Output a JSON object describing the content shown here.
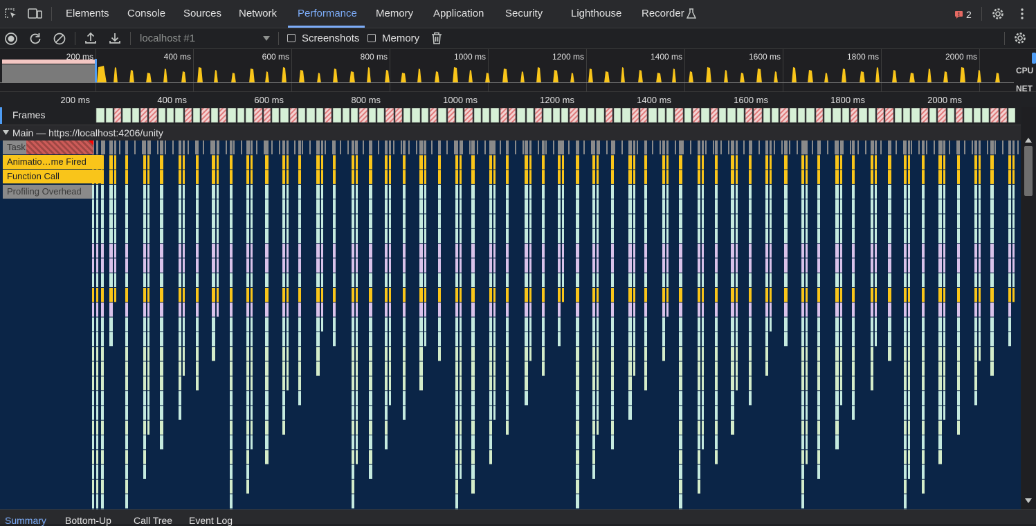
{
  "tabs": [
    {
      "label": "Elements"
    },
    {
      "label": "Console"
    },
    {
      "label": "Sources"
    },
    {
      "label": "Network"
    },
    {
      "label": "Performance",
      "active": true
    },
    {
      "label": "Memory"
    },
    {
      "label": "Application"
    },
    {
      "label": "Security"
    },
    {
      "label": "Lighthouse"
    },
    {
      "label": "Recorder"
    }
  ],
  "issues": {
    "count": "2",
    "color": "#e46962"
  },
  "toolbar": {
    "target_placeholder": "localhost #1",
    "screenshots_label": "Screenshots",
    "screenshots_checked": false,
    "memory_label": "Memory",
    "memory_checked": false
  },
  "overview": {
    "ticks": [
      "200 ms",
      "400 ms",
      "600 ms",
      "800 ms",
      "1000 ms",
      "1200 ms",
      "1400 ms",
      "1600 ms",
      "1800 ms",
      "2000 ms"
    ],
    "cpu_label": "CPU",
    "net_label": "NET",
    "cpu_color": "#f9c51a"
  },
  "ruler": {
    "ticks": [
      "200 ms",
      "400 ms",
      "600 ms",
      "800 ms",
      "1000 ms",
      "1200 ms",
      "1400 ms",
      "1600 ms",
      "1800 ms",
      "2000 ms"
    ]
  },
  "frames": {
    "label": "Frames",
    "good_color": "#d6f0d6",
    "dropped_color": "#e07b7b"
  },
  "main_track": {
    "label": "Main — https://localhost:4206/unity"
  },
  "flame": {
    "lanes": [
      {
        "label": "Task",
        "color": "#8a8a8a"
      },
      {
        "label": "Animatio…me Fired",
        "color": "#f9c51a"
      },
      {
        "label": "Function Call",
        "color": "#f9c51a"
      },
      {
        "label": "Profiling Overhead",
        "color": "#8a8a8a"
      }
    ],
    "background": "#0b2547",
    "row_colors": [
      "#8a8a8a",
      "#f9c51a",
      "#f9c51a",
      "#c5eadf",
      "#c5eadf",
      "#c5eadf",
      "#c5eadf",
      "#d9c2ea",
      "#d9c2ea",
      "#c5eadf",
      "#f9c51a",
      "#d9c2ea",
      "#c5eadf",
      "#c5eadf",
      "#d4ecc9",
      "#d4ecc9",
      "#d4ecc9",
      "#c5eadf",
      "#c5eadf",
      "#d4ecc9",
      "#c5eadf",
      "#d4ecc9",
      "#c5eadf",
      "#d4ecc9",
      "#c5eadf",
      "#c5eadf"
    ]
  },
  "bottom_tabs": [
    {
      "label": "Summary",
      "active": true
    },
    {
      "label": "Bottom-Up"
    },
    {
      "label": "Call Tree"
    },
    {
      "label": "Event Log"
    }
  ]
}
